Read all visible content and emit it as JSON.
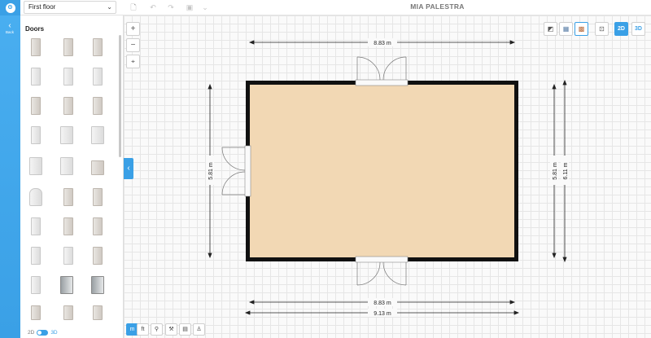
{
  "topbar": {
    "floor_select": "First floor",
    "app_title": "MIA PALESTRA"
  },
  "sidebar": {
    "back_label": "Back",
    "category_title": "Doors"
  },
  "view_toggle": {
    "label_2d": "2D",
    "label_3d": "3D"
  },
  "canvas": {
    "zoom_in": "+",
    "zoom_out": "−",
    "mode_2d": "2D",
    "mode_3d": "3D",
    "dimensions": {
      "top": "8.83 m",
      "bottom_inner": "8.83 m",
      "bottom_outer": "9.13 m",
      "left": "5.81 m",
      "right_inner": "5.81 m",
      "right_outer": "6.11 m"
    },
    "colors": {
      "floor": "#f2d8b4",
      "wall": "#111111",
      "accent": "#3aa0e6"
    }
  },
  "bottom_tools": {
    "meters": "m",
    "feet": "ft"
  }
}
